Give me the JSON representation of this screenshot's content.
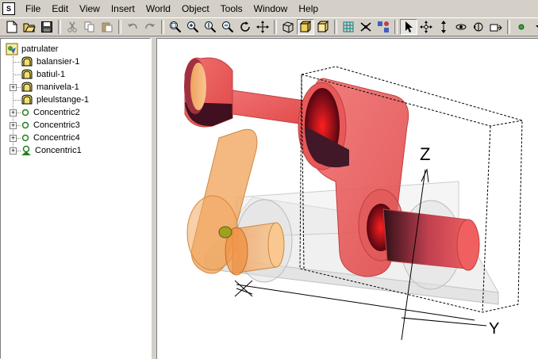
{
  "menu": {
    "items": [
      {
        "label": "File"
      },
      {
        "label": "Edit"
      },
      {
        "label": "View"
      },
      {
        "label": "Insert"
      },
      {
        "label": "World"
      },
      {
        "label": "Object"
      },
      {
        "label": "Tools"
      },
      {
        "label": "Window"
      },
      {
        "label": "Help"
      }
    ]
  },
  "tree": {
    "root": {
      "label": "patrulater",
      "icon": "assembly-icon"
    },
    "items": [
      {
        "label": "balansier-1",
        "icon": "part-icon"
      },
      {
        "label": "batiul-1",
        "icon": "part-icon"
      },
      {
        "label": "manivela-1",
        "icon": "part-icon"
      },
      {
        "label": "pleulstange-1",
        "icon": "part-icon"
      },
      {
        "label": "Concentric2",
        "icon": "constraint-icon"
      },
      {
        "label": "Concentric3",
        "icon": "constraint-icon"
      },
      {
        "label": "Concentric4",
        "icon": "constraint-icon"
      },
      {
        "label": "Concentric1",
        "icon": "constraint-ground-icon"
      }
    ]
  },
  "viewport": {
    "axis_z": "Z",
    "axis_y": "Y",
    "colors": {
      "crank": "#e85c5c",
      "rocker": "#f0b070",
      "base": "#d8d8d8"
    }
  }
}
